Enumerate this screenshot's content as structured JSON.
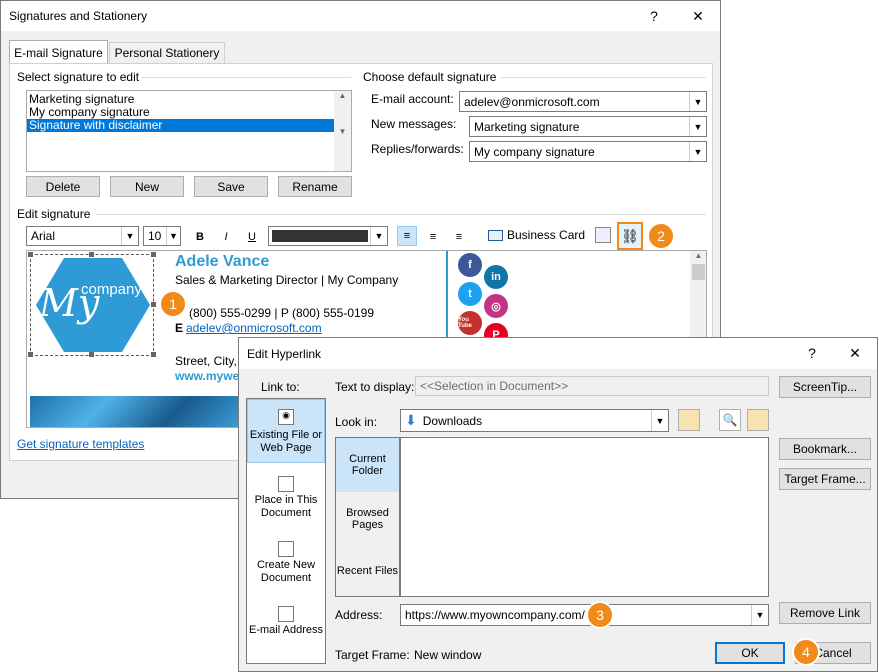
{
  "sig_dialog": {
    "title": "Signatures and Stationery",
    "help": "?",
    "close": "✕",
    "tabs": [
      "E-mail Signature",
      "Personal Stationery"
    ],
    "select_label": "Select signature to edit",
    "signatures": [
      "Marketing signature",
      "My company signature",
      "Signature with disclaimer"
    ],
    "buttons": {
      "delete": "Delete",
      "new": "New",
      "save": "Save",
      "rename": "Rename"
    },
    "default_label": "Choose default signature",
    "email_account_label": "E-mail account:",
    "email_account_value": "adelev@onmicrosoft.com",
    "new_messages_label": "New messages:",
    "new_messages_value": "Marketing signature",
    "replies_label": "Replies/forwards:",
    "replies_value": "My company signature",
    "edit_label": "Edit signature",
    "font": "Arial",
    "size": "10",
    "bold": "B",
    "italic": "I",
    "underline": "U",
    "business_card": "Business Card",
    "templates_link": "Get signature templates",
    "badge1": "1",
    "badge2": "2"
  },
  "signature": {
    "logo_text": "company",
    "logo_script": "My",
    "name": "Adele Vance",
    "title": "Sales & Marketing Director | My Company",
    "phone_line": "(800) 555-0299 | P (800) 555-0199",
    "email_prefix": "E",
    "email": "adelev@onmicrosoft.com",
    "street": "Street, City,",
    "web": "www.mywe",
    "social": {
      "facebook": "f",
      "linkedin": "in",
      "twitter": "t",
      "instagram": "◎",
      "youtube": "You Tube",
      "pinterest": "P"
    }
  },
  "hyperlink_dialog": {
    "title": "Edit Hyperlink",
    "help": "?",
    "close": "✕",
    "link_to": "Link to:",
    "nav": [
      {
        "label": "Existing File or Web Page"
      },
      {
        "label": "Place in This Document"
      },
      {
        "label": "Create New Document"
      },
      {
        "label": "E-mail Address"
      }
    ],
    "text_to_display_label": "Text to display:",
    "text_to_display_value": "<<Selection in Document>>",
    "screentip": "ScreenTip...",
    "look_in_label": "Look in:",
    "look_in_value": "Downloads",
    "browse_tabs": [
      "Current Folder",
      "Browsed Pages",
      "Recent Files"
    ],
    "bookmark": "Bookmark...",
    "target_frame_btn": "Target Frame...",
    "address_label": "Address:",
    "address_value": "https://www.myowncompany.com/",
    "remove_link": "Remove Link",
    "target_frame_label": "Target Frame:",
    "target_frame_value": "New window",
    "ok": "OK",
    "cancel": "Cancel",
    "badge3": "3",
    "badge4": "4"
  },
  "colors": {
    "accent": "#2e9bd6",
    "select_blue": "#0078d7",
    "badge": "#f28a1a",
    "link": "#0563c1"
  }
}
